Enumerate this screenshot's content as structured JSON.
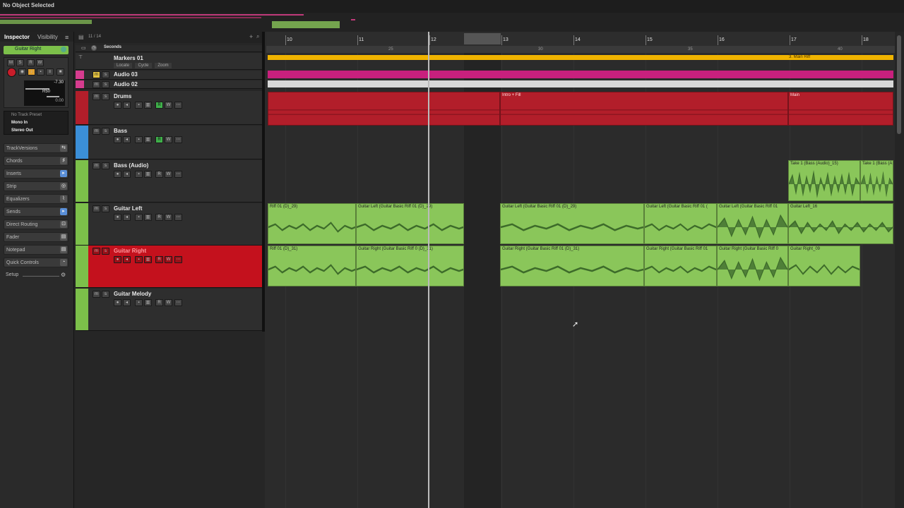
{
  "topbar": {
    "title": "No Object Selected"
  },
  "inspector": {
    "tabs": [
      "Inspector",
      "Visibility"
    ],
    "track_name": "Guitar Right",
    "volume": "-7.30",
    "pan": "R50",
    "send": "0.00",
    "preset": "No Track Preset",
    "input": "Mono In",
    "output": "Stereo Out",
    "sections": [
      "TrackVersions",
      "Chords",
      "Inserts",
      "Strip",
      "Equalizers",
      "Sends",
      "Direct Routing",
      "Fader",
      "Notepad",
      "Quick Controls"
    ],
    "setup": "Setup"
  },
  "tracklist": {
    "count": "11 / 14",
    "ruler_label": "Seconds",
    "marker_track": {
      "name": "Markers 01",
      "buttons": [
        "Locate",
        "Cycle",
        "Zoom"
      ]
    },
    "tracks": [
      {
        "name": "Audio 03",
        "color": "#d63c8f"
      },
      {
        "name": "Audio 02",
        "color": "#d63c8f"
      },
      {
        "name": "Drums",
        "color": "#b21e2a"
      },
      {
        "name": "Bass",
        "color": "#3b8fd8"
      },
      {
        "name": "Bass (Audio)",
        "color": "#7cc04a"
      },
      {
        "name": "Guitar Left",
        "color": "#7cc04a"
      },
      {
        "name": "Guitar Right",
        "color": "#7cc04a"
      },
      {
        "name": "Guitar Melody",
        "color": "#7cc04a"
      }
    ]
  },
  "ruler": {
    "bars": [
      "10",
      "11",
      "12",
      "13",
      "14",
      "15",
      "16",
      "17",
      "18"
    ],
    "seconds": [
      "25",
      "30",
      "35",
      "40"
    ]
  },
  "markers": {
    "main_riff": "3. Main Riff"
  },
  "clips": {
    "drums_intro": "Intro + Fill",
    "drums_main": "Main",
    "bass_take1": "Take 1 (Bass (Audio)_15)",
    "bass_take1b": "Take 1 (Bass (A",
    "gl_1": "Riff 01 (D)_29)",
    "gl_2": "Guitar Left (Guitar Basic Riff 01 (D)_29)",
    "gl_3": "Guitar Left (Guitar Basic Riff 01 (D)_29)",
    "gl_4": "Guitar Left (Guitar Basic Riff 01 (",
    "gl_5": "Guitar Left (Guitar Basic Riff 01",
    "gl_6": "Guitar Left_16",
    "gr_1": "Riff 01 (D)_31)",
    "gr_2": "Guitar Right (Guitar Basic Riff 0 (D)_31)",
    "gr_3": "Guitar Right (Guitar Basic Riff 01 (D)_31)",
    "gr_4": "Guitar Right (Guitar Basic Riff 01",
    "gr_5": "Guitar Right (Guitar Basic Riff 0",
    "gr_6": "Guitar Right_09"
  }
}
